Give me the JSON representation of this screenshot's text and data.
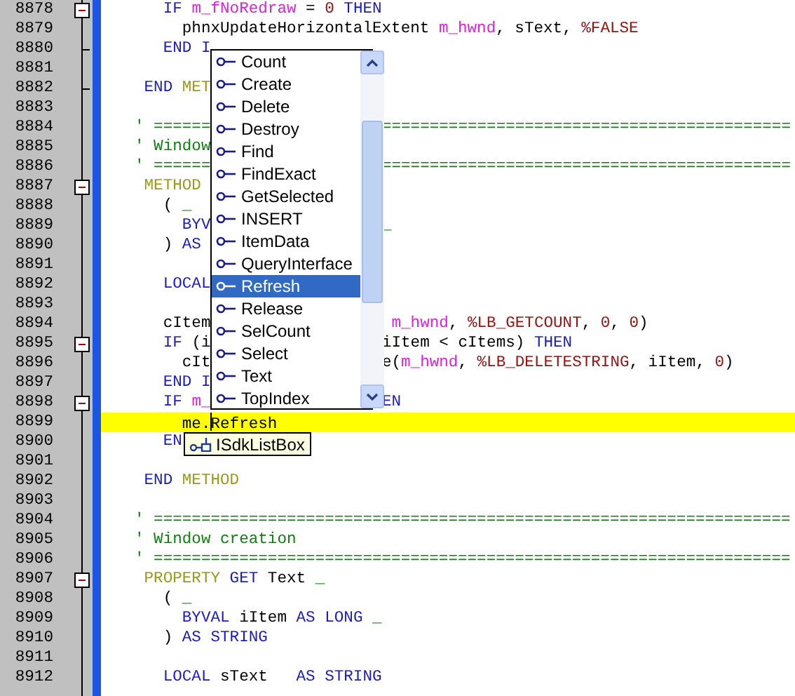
{
  "editor": {
    "lines": [
      {
        "number": "8878",
        "fold_box": true,
        "fold_end": false,
        "segments": [
          {
            "kind": "kw",
            "text": "   IF "
          },
          {
            "kind": "var",
            "text": "m_fNoRedraw"
          },
          {
            "kind": "plain",
            "text": " = "
          },
          {
            "kind": "const",
            "text": "0"
          },
          {
            "kind": "kw",
            "text": " THEN"
          }
        ]
      },
      {
        "number": "8879",
        "fold_box": false,
        "fold_end": false,
        "segments": [
          {
            "kind": "plain",
            "text": "     phnxUpdateHorizontalExtent "
          },
          {
            "kind": "var",
            "text": "m_hwnd"
          },
          {
            "kind": "plain",
            "text": ", sText, "
          },
          {
            "kind": "const",
            "text": "%FALSE"
          }
        ]
      },
      {
        "number": "8880",
        "fold_box": false,
        "fold_end": true,
        "segments": [
          {
            "kind": "kw",
            "text": "   END I"
          }
        ]
      },
      {
        "number": "8881",
        "fold_box": false,
        "fold_end": false
      },
      {
        "number": "8882",
        "fold_box": false,
        "fold_end": true,
        "segments": [
          {
            "kind": "kw",
            "text": " END "
          },
          {
            "kind": "decl",
            "text": "MET"
          }
        ]
      },
      {
        "number": "8883",
        "fold_box": false,
        "fold_end": false
      },
      {
        "number": "8884",
        "fold_box": false,
        "fold_end": false,
        "segments": [
          {
            "kind": "comment",
            "text": "' ======"
          }
        ],
        "right_fragment": [
          {
            "kind": "comment",
            "text": "==========================================="
          }
        ]
      },
      {
        "number": "8885",
        "fold_box": false,
        "fold_end": false,
        "segments": [
          {
            "kind": "comment",
            "text": "' Window"
          }
        ]
      },
      {
        "number": "8886",
        "fold_box": false,
        "fold_end": false,
        "segments": [
          {
            "kind": "comment",
            "text": "' ======"
          }
        ],
        "right_fragment": [
          {
            "kind": "comment",
            "text": "==========================================="
          }
        ]
      },
      {
        "number": "8887",
        "fold_box": true,
        "fold_end": false,
        "segments": [
          {
            "kind": "decl",
            "text": " METHOD"
          }
        ]
      },
      {
        "number": "8888",
        "fold_box": false,
        "fold_end": false,
        "segments": [
          {
            "kind": "plain",
            "text": "   ( "
          },
          {
            "kind": "cont",
            "text": "_"
          }
        ]
      },
      {
        "number": "8889",
        "fold_box": false,
        "fold_end": false,
        "segments": [
          {
            "kind": "kw",
            "text": "     BYV"
          }
        ],
        "right_fragment": [
          {
            "kind": "cont",
            "text": "_"
          }
        ]
      },
      {
        "number": "8890",
        "fold_box": false,
        "fold_end": false,
        "segments": [
          {
            "kind": "plain",
            "text": "   ) "
          },
          {
            "kind": "kw",
            "text": "AS"
          }
        ]
      },
      {
        "number": "8891",
        "fold_box": false,
        "fold_end": false
      },
      {
        "number": "8892",
        "fold_box": false,
        "fold_end": false,
        "segments": [
          {
            "kind": "kw",
            "text": "   LOCAL"
          }
        ]
      },
      {
        "number": "8893",
        "fold_box": false,
        "fold_end": false
      },
      {
        "number": "8894",
        "fold_box": false,
        "fold_end": false,
        "segments": [
          {
            "kind": "plain",
            "text": "   cItem"
          }
        ],
        "right_fragment": [
          {
            "kind": "var",
            "text": " m_hwnd"
          },
          {
            "kind": "plain",
            "text": ", "
          },
          {
            "kind": "const",
            "text": "%LB_GETCOUNT"
          },
          {
            "kind": "plain",
            "text": ", "
          },
          {
            "kind": "const",
            "text": "0"
          },
          {
            "kind": "plain",
            "text": ", "
          },
          {
            "kind": "const",
            "text": "0"
          },
          {
            "kind": "plain",
            "text": ")"
          }
        ]
      },
      {
        "number": "8895",
        "fold_box": true,
        "fold_end": false,
        "segments": [
          {
            "kind": "kw",
            "text": "   IF "
          },
          {
            "kind": "plain",
            "text": "(i"
          }
        ],
        "right_fragment": [
          {
            "kind": "plain",
            "text": "iItem < cItems) "
          },
          {
            "kind": "kw",
            "text": "THEN"
          }
        ]
      },
      {
        "number": "8896",
        "fold_box": false,
        "fold_end": false,
        "segments": [
          {
            "kind": "plain",
            "text": "     cIt"
          }
        ],
        "right_fragment": [
          {
            "kind": "plain",
            "text": "e("
          },
          {
            "kind": "var",
            "text": "m_hwnd"
          },
          {
            "kind": "plain",
            "text": ", "
          },
          {
            "kind": "const",
            "text": "%LB_DELETESTRING"
          },
          {
            "kind": "plain",
            "text": ", iItem, "
          },
          {
            "kind": "const",
            "text": "0"
          },
          {
            "kind": "plain",
            "text": ")"
          }
        ]
      },
      {
        "number": "8897",
        "fold_box": false,
        "fold_end": false,
        "segments": [
          {
            "kind": "kw",
            "text": "   END I"
          }
        ]
      },
      {
        "number": "8898",
        "fold_box": true,
        "fold_end": false,
        "segments": [
          {
            "kind": "kw",
            "text": "   IF "
          },
          {
            "kind": "var",
            "text": "m_"
          }
        ],
        "right_fragment": [
          {
            "kind": "kw",
            "text": "EN"
          }
        ]
      },
      {
        "number": "8899",
        "fold_box": false,
        "fold_end": false,
        "current": true,
        "segments": [
          {
            "kind": "plain",
            "text": "     me."
          },
          {
            "kind": "caret"
          },
          {
            "kind": "plain",
            "text": "Refresh"
          }
        ]
      },
      {
        "number": "8900",
        "fold_box": false,
        "fold_end": false,
        "segments": [
          {
            "kind": "kw",
            "text": "   EN"
          }
        ]
      },
      {
        "number": "8901",
        "fold_box": false,
        "fold_end": false
      },
      {
        "number": "8902",
        "fold_box": false,
        "fold_end": false,
        "segments": [
          {
            "kind": "kw",
            "text": " END "
          },
          {
            "kind": "decl",
            "text": "METHOD"
          }
        ]
      },
      {
        "number": "8903",
        "fold_box": false,
        "fold_end": false
      },
      {
        "number": "8904",
        "fold_box": false,
        "fold_end": false,
        "segments": [
          {
            "kind": "comment",
            "text": "' ==================================================================="
          }
        ]
      },
      {
        "number": "8905",
        "fold_box": false,
        "fold_end": false,
        "segments": [
          {
            "kind": "comment",
            "text": "' Window creation"
          }
        ]
      },
      {
        "number": "8906",
        "fold_box": false,
        "fold_end": false,
        "segments": [
          {
            "kind": "comment",
            "text": "' ==================================================================="
          }
        ]
      },
      {
        "number": "8907",
        "fold_box": true,
        "fold_end": false,
        "segments": [
          {
            "kind": "decl",
            "text": " PROPERTY "
          },
          {
            "kind": "kw",
            "text": "GET"
          },
          {
            "kind": "plain",
            "text": " Text "
          },
          {
            "kind": "cont",
            "text": "_"
          }
        ]
      },
      {
        "number": "8908",
        "fold_box": false,
        "fold_end": false,
        "segments": [
          {
            "kind": "plain",
            "text": "   ( "
          },
          {
            "kind": "cont",
            "text": "_"
          }
        ]
      },
      {
        "number": "8909",
        "fold_box": false,
        "fold_end": false,
        "segments": [
          {
            "kind": "kw",
            "text": "     BYVAL"
          },
          {
            "kind": "plain",
            "text": " iItem "
          },
          {
            "kind": "kw",
            "text": "AS LONG "
          },
          {
            "kind": "cont",
            "text": "_"
          }
        ]
      },
      {
        "number": "8910",
        "fold_box": false,
        "fold_end": false,
        "segments": [
          {
            "kind": "plain",
            "text": "   ) "
          },
          {
            "kind": "kw",
            "text": "AS STRING"
          }
        ]
      },
      {
        "number": "8911",
        "fold_box": false,
        "fold_end": false
      },
      {
        "number": "8912",
        "fold_box": false,
        "fold_end": false,
        "segments": [
          {
            "kind": "kw",
            "text": "   LOCAL"
          },
          {
            "kind": "plain",
            "text": " sText   "
          },
          {
            "kind": "kw",
            "text": "AS STRING"
          }
        ]
      }
    ]
  },
  "completion_list": {
    "items": [
      {
        "label": "Count",
        "selected": false
      },
      {
        "label": "Create",
        "selected": false
      },
      {
        "label": "Delete",
        "selected": false
      },
      {
        "label": "Destroy",
        "selected": false
      },
      {
        "label": "Find",
        "selected": false
      },
      {
        "label": "FindExact",
        "selected": false
      },
      {
        "label": "GetSelected",
        "selected": false
      },
      {
        "label": "INSERT",
        "selected": false
      },
      {
        "label": "ItemData",
        "selected": false
      },
      {
        "label": "QueryInterface",
        "selected": false
      },
      {
        "label": "Refresh",
        "selected": true
      },
      {
        "label": "Release",
        "selected": false
      },
      {
        "label": "SelCount",
        "selected": false
      },
      {
        "label": "Select",
        "selected": false
      },
      {
        "label": "Text",
        "selected": false
      },
      {
        "label": "TopIndex",
        "selected": false
      }
    ]
  },
  "tooltip": {
    "text": "ISdkListBox"
  }
}
